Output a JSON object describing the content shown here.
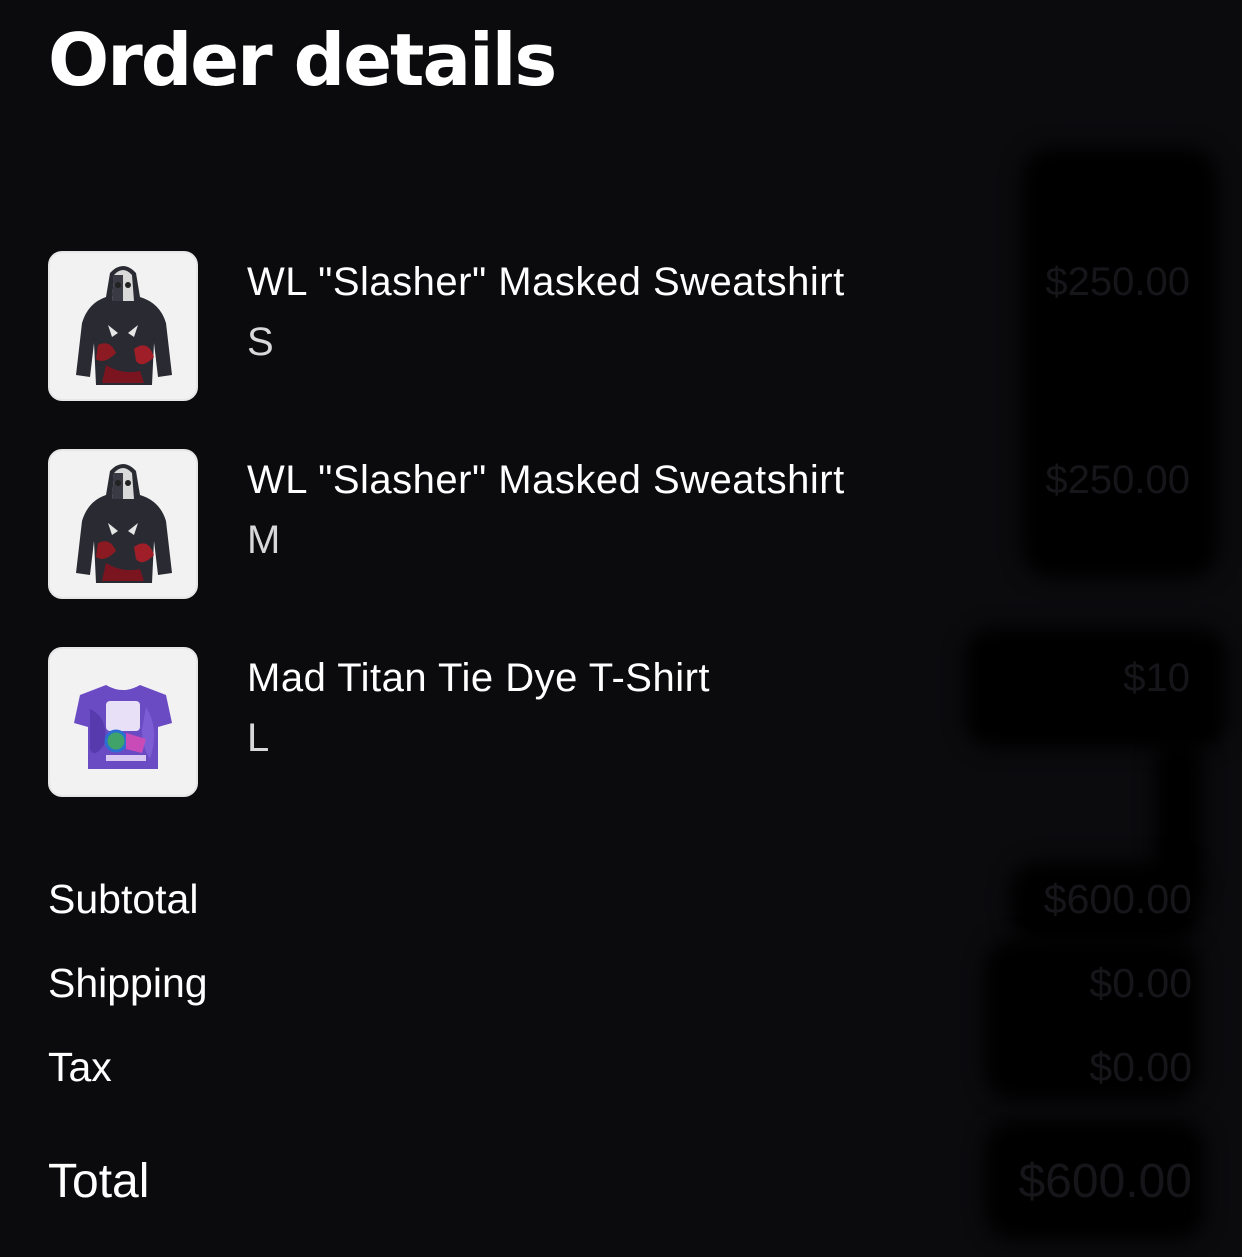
{
  "header": {
    "title": "Order details"
  },
  "items": [
    {
      "name": "WL \"Slasher\" Masked Sweatshirt",
      "variant": "S",
      "price": "$250.00",
      "icon": "hoodie-thumbnail"
    },
    {
      "name": "WL \"Slasher\" Masked Sweatshirt",
      "variant": "M",
      "price": "$250.00",
      "icon": "hoodie-thumbnail"
    },
    {
      "name": "Mad Titan Tie Dye T-Shirt",
      "variant": "L",
      "price": "$10",
      "icon": "tshirt-thumbnail"
    }
  ],
  "summary": {
    "subtotal_label": "Subtotal",
    "subtotal_value": "$600.00",
    "shipping_label": "Shipping",
    "shipping_value": "$0.00",
    "tax_label": "Tax",
    "tax_value": "$0.00",
    "total_label": "Total",
    "total_value": "$600.00"
  },
  "colors": {
    "background": "#0b0b0e",
    "text": "#ffffff",
    "thumbnail_bg": "#f2f2f2"
  }
}
